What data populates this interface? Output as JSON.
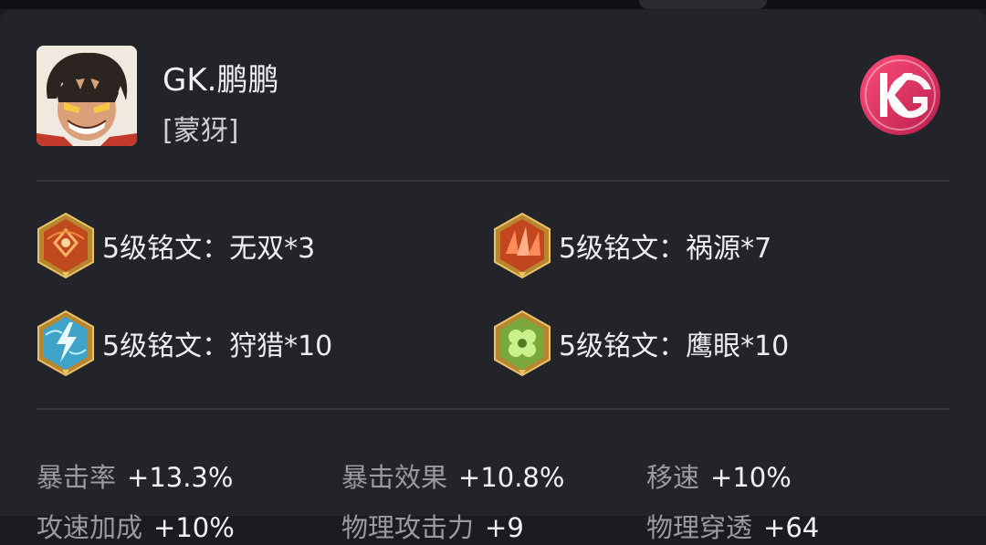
{
  "player": {
    "name": "GK.鹏鹏",
    "hero": "[蒙犽]"
  },
  "team": {
    "logo_text": "KG",
    "logo_color": "#d9335f"
  },
  "runes": [
    {
      "label": "5级铭文：无双*3",
      "color": "red",
      "icon": "rune-wushuang-icon"
    },
    {
      "label": "5级铭文：祸源*7",
      "color": "red",
      "icon": "rune-huoyuan-icon"
    },
    {
      "label": "5级铭文：狩猎*10",
      "color": "blue",
      "icon": "rune-shoulie-icon"
    },
    {
      "label": "5级铭文：鹰眼*10",
      "color": "green",
      "icon": "rune-yingyan-icon"
    }
  ],
  "stats": [
    {
      "name": "暴击率",
      "value": "+13.3%"
    },
    {
      "name": "暴击效果",
      "value": "+10.8%"
    },
    {
      "name": "移速",
      "value": "+10%"
    },
    {
      "name": "攻速加成",
      "value": "+10%"
    },
    {
      "name": "物理攻击力",
      "value": "+9"
    },
    {
      "name": "物理穿透",
      "value": "+64"
    }
  ]
}
